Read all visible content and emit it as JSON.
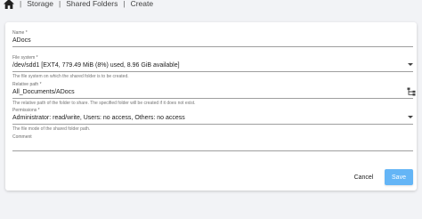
{
  "breadcrumb": {
    "items": [
      "Storage",
      "Shared Folders",
      "Create"
    ],
    "separator": "|"
  },
  "form": {
    "name": {
      "label": "Name *",
      "value": "ADocs"
    },
    "filesystem": {
      "label": "File system *",
      "value": "/dev/sdd1 [EXT4, 779.49 MiB (8%) used, 8.96 GiB available]",
      "hint": "The file system on which the shared folder is to be created."
    },
    "relpath": {
      "label": "Relative path *",
      "value": "All_Documents/ADocs",
      "hint": "The relative path of the folder to share. The specified folder will be created if it does not exist."
    },
    "permissions": {
      "label": "Permissions *",
      "value": "Administrator: read/write, Users: no access, Others: no access",
      "hint": "The file mode of the shared folder path."
    },
    "comment": {
      "label": "Comment",
      "value": ""
    }
  },
  "actions": {
    "cancel": "Cancel",
    "save": "Save"
  },
  "colors": {
    "primary_disabled": "#64b5f6",
    "background": "#f2f3f6"
  },
  "icons": {
    "home": "home-icon",
    "dropdown": "chevron-down-icon",
    "tree": "folder-tree-icon"
  }
}
